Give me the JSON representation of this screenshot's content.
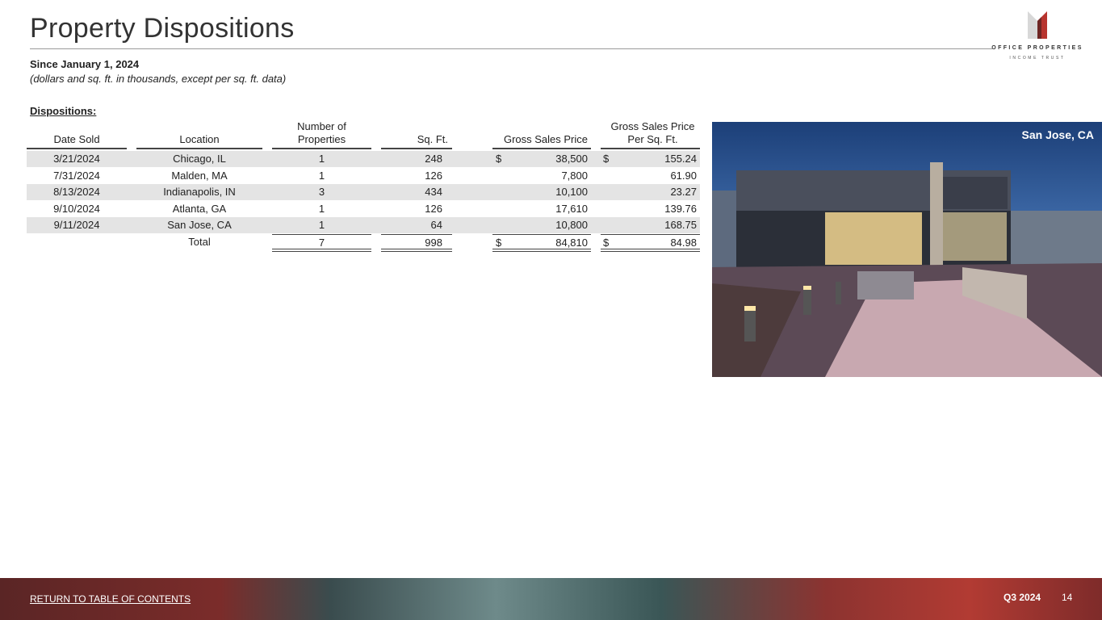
{
  "header": {
    "title": "Property Dispositions",
    "logo_line1": "OFFICE PROPERTIES",
    "logo_line2": "INCOME TRUST"
  },
  "subtitle": "Since January 1, 2024",
  "note": "(dollars and sq. ft. in thousands, except per sq. ft. data)",
  "section_label": "Dispositions:",
  "table": {
    "columns": [
      "Date Sold",
      "Location",
      "Number of Properties",
      "Sq. Ft.",
      "Gross Sales Price",
      "Gross Sales Price Per Sq. Ft."
    ],
    "rows": [
      {
        "date": "3/21/2024",
        "location": "Chicago, IL",
        "num": "1",
        "sqft": "248",
        "cur1": "$",
        "price": "38,500",
        "cur2": "$",
        "per": "155.24"
      },
      {
        "date": "7/31/2024",
        "location": "Malden, MA",
        "num": "1",
        "sqft": "126",
        "cur1": "",
        "price": "7,800",
        "cur2": "",
        "per": "61.90"
      },
      {
        "date": "8/13/2024",
        "location": "Indianapolis, IN",
        "num": "3",
        "sqft": "434",
        "cur1": "",
        "price": "10,100",
        "cur2": "",
        "per": "23.27"
      },
      {
        "date": "9/10/2024",
        "location": "Atlanta, GA",
        "num": "1",
        "sqft": "126",
        "cur1": "",
        "price": "17,610",
        "cur2": "",
        "per": "139.76"
      },
      {
        "date": "9/11/2024",
        "location": "San Jose, CA",
        "num": "1",
        "sqft": "64",
        "cur1": "",
        "price": "10,800",
        "cur2": "",
        "per": "168.75"
      }
    ],
    "total": {
      "label": "Total",
      "num": "7",
      "sqft": "998",
      "cur1": "$",
      "price": "84,810",
      "cur2": "$",
      "per": "84.98"
    }
  },
  "photo": {
    "caption": "San Jose, CA"
  },
  "footer": {
    "return_link": "RETURN TO TABLE OF CONTENTS",
    "quarter": "Q3 2024",
    "page": "14"
  }
}
